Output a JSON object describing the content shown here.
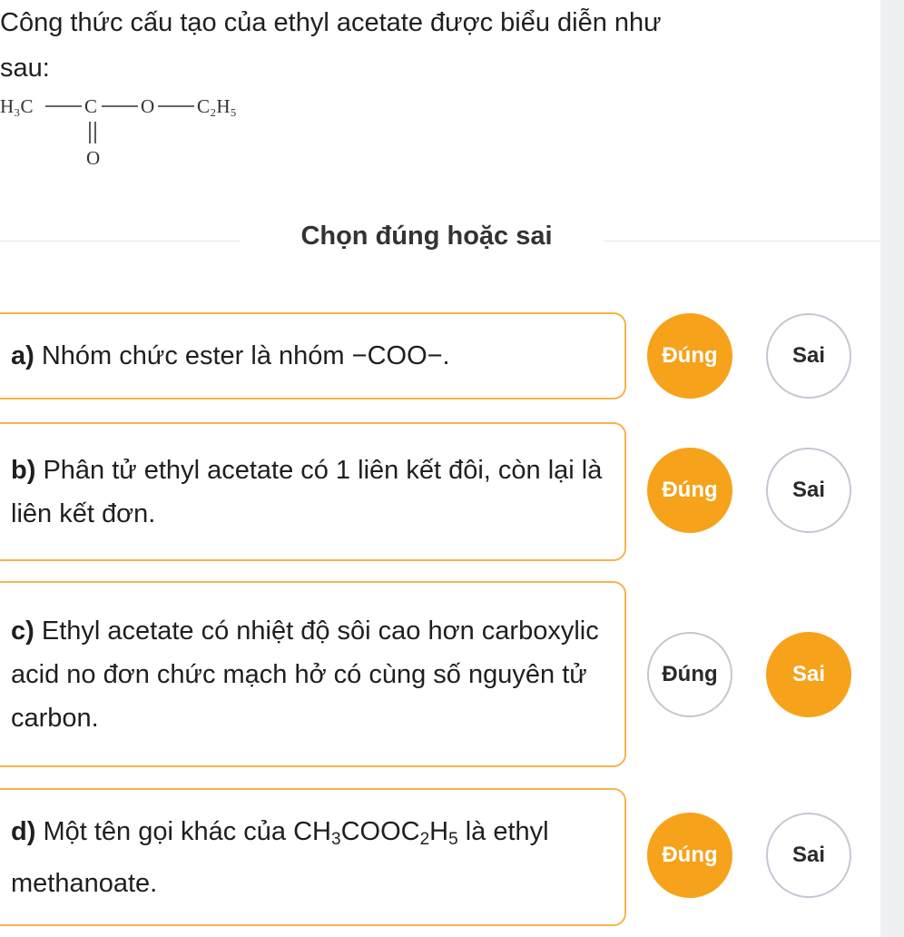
{
  "question": {
    "intro_line1": "Công thức cấu tạo của ethyl acetate được biểu diễn như",
    "intro_line2": "sau:",
    "formula": {
      "left_group": "H₃C",
      "carbon": "C",
      "oxygen_bridge": "O",
      "right_group": "C₂H₅",
      "carbonyl_oxygen": "O"
    }
  },
  "section": {
    "title": "Chọn đúng hoặc sai"
  },
  "choice_labels": {
    "true": "Đúng",
    "false": "Sai"
  },
  "statements": [
    {
      "letter": "a)",
      "text": "Nhóm chức ester là nhóm −COO−.",
      "selected": "true"
    },
    {
      "letter": "b)",
      "text": "Phân tử ethyl acetate có 1 liên kết đôi, còn lại là liên kết đơn.",
      "selected": "true"
    },
    {
      "letter": "c)",
      "text": "Ethyl acetate có nhiệt độ sôi cao hơn carboxylic acid no đơn chức mạch hở có cùng số nguyên tử carbon.",
      "selected": "false"
    },
    {
      "letter": "d)",
      "text_before": "Một tên gọi khác của ",
      "formula_parts": [
        "CH",
        "3",
        "COOC",
        "2",
        "H",
        "5"
      ],
      "text_after": " là ethyl methanoate.",
      "selected": "true"
    }
  ],
  "colors": {
    "accent": "#f7a21b",
    "card_border": "#f6b44b",
    "neutral_border": "#c2c8d3"
  }
}
